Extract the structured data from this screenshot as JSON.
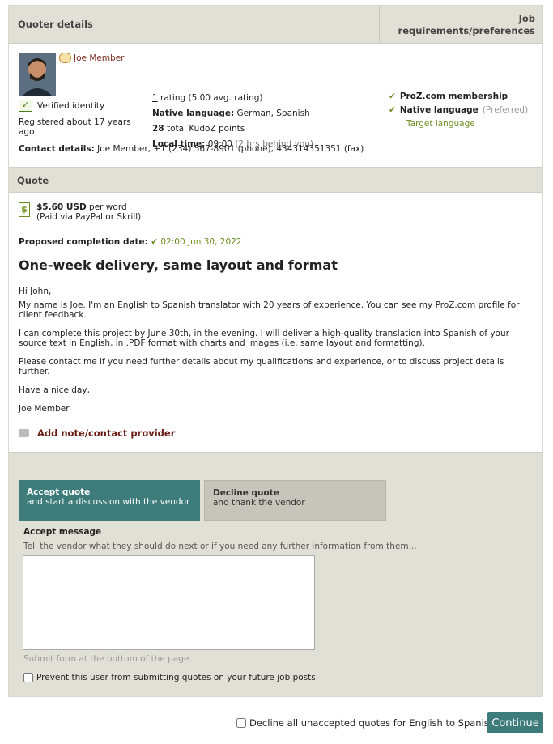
{
  "header": {
    "quoter_details_label": "Quoter details",
    "job_requirements_label": "Job requirements/preferences"
  },
  "quoter": {
    "name": "Joe Member",
    "verified_label": "Verified identity",
    "registered": "Registered about 17 years ago",
    "contact_label": "Contact details:",
    "contact_value": "Joe Member, +1 (234) 567-8901 (phone), 434314351351 (fax)",
    "rating_count": "1",
    "rating_text": "rating (5.00 avg. rating)",
    "native_label": "Native language:",
    "native_value": "German, Spanish",
    "kudoz_count": "28",
    "kudoz_text": "total KudoZ points",
    "local_time_label": "Local time:",
    "local_time_value": "09:00",
    "local_time_note": "(2 hrs behind you)"
  },
  "requirements": {
    "membership": "ProZ.com membership",
    "native_language": "Native language",
    "preferred": "(Preferred)",
    "target": "Target language"
  },
  "quote": {
    "section_label": "Quote",
    "price_amount": "$5.60 USD",
    "price_unit": "per word",
    "payment": "(Paid via PayPal or Skrill)",
    "proposed_label": "Proposed completion date:",
    "proposed_date": "02:00 Jun 30, 2022",
    "title": "One-week delivery, same layout and format",
    "message": [
      "Hi John,",
      "My name is Joe. I'm an English to Spanish translator with 20 years of experience. You can see my ProZ.com profile for client feedback.",
      "I can complete this project by June 30th, in the evening. I will deliver a high-quality translation into Spanish of your source text in English, in .PDF format with charts and images (i.e. same layout and formatting).",
      "Please contact me if you need further details about my qualifications and experience, or to discuss project details further.",
      "Have a nice day,",
      "Joe Member"
    ],
    "add_note": "Add note/contact provider"
  },
  "actions": {
    "accept_title": "Accept quote",
    "accept_sub": "and start a discussion with the vendor",
    "decline_title": "Decline quote",
    "decline_sub": "and thank the vendor",
    "accept_msg_label": "Accept message",
    "accept_msg_hint": "Tell the vendor what they should do next or if you need any further information from them...",
    "submit_hint": "Submit form at the bottom of the page.",
    "prevent_label": "Prevent this user from submitting quotes on your future job posts",
    "decline_all_label": "Decline all unaccepted quotes for English to Spanish",
    "continue_label": "Continue"
  },
  "colors": {
    "accent": "#3e7b7b",
    "header_bg": "#e1e0d6",
    "check_green": "#6b8e23",
    "note_red": "#6a1d12"
  }
}
